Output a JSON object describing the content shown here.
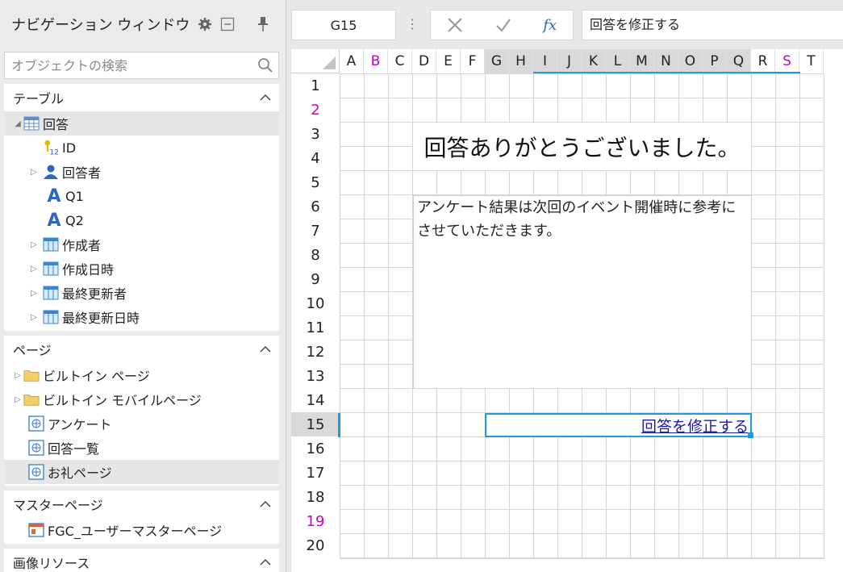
{
  "nav": {
    "title": "ナビゲーション ウィンドウ",
    "search_placeholder": "オブジェクトの検索",
    "tables": {
      "heading": "テーブル",
      "table_name": "回答",
      "fields": [
        {
          "label": "ID",
          "icon": "key-number-icon",
          "expandable": false
        },
        {
          "label": "回答者",
          "icon": "user-icon",
          "expandable": true
        },
        {
          "label": "Q1",
          "icon": "text-field-icon",
          "expandable": false
        },
        {
          "label": "Q2",
          "icon": "text-field-icon",
          "expandable": false
        },
        {
          "label": "作成者",
          "icon": "table-icon",
          "expandable": true
        },
        {
          "label": "作成日時",
          "icon": "table-icon",
          "expandable": true
        },
        {
          "label": "最終更新者",
          "icon": "table-icon",
          "expandable": true
        },
        {
          "label": "最終更新日時",
          "icon": "table-icon",
          "expandable": true
        }
      ]
    },
    "pages": {
      "heading": "ページ",
      "items": [
        {
          "label": "ビルトイン ページ",
          "icon": "folder-icon",
          "expandable": true
        },
        {
          "label": "ビルトイン モバイルページ",
          "icon": "folder-icon",
          "expandable": true
        },
        {
          "label": "アンケート",
          "icon": "page-icon",
          "expandable": false
        },
        {
          "label": "回答一覧",
          "icon": "page-icon",
          "expandable": false
        },
        {
          "label": "お礼ページ",
          "icon": "page-icon",
          "expandable": false,
          "selected": true
        }
      ]
    },
    "master": {
      "heading": "マスターページ",
      "items": [
        {
          "label": "FGC_ユーザーマスターページ",
          "icon": "master-page-icon"
        }
      ]
    },
    "images": {
      "heading": "画像リソース"
    }
  },
  "formula_bar": {
    "cell_ref": "G15",
    "formula": "回答を修正する",
    "fx": "fx"
  },
  "sheet": {
    "columns": [
      "A",
      "B",
      "C",
      "D",
      "E",
      "F",
      "G",
      "H",
      "I",
      "J",
      "K",
      "L",
      "M",
      "N",
      "O",
      "P",
      "Q",
      "R",
      "S",
      "T"
    ],
    "rows": [
      "1",
      "2",
      "3",
      "4",
      "5",
      "6",
      "7",
      "8",
      "9",
      "10",
      "11",
      "12",
      "13",
      "14",
      "15",
      "16",
      "17",
      "18",
      "19",
      "20"
    ],
    "title_text": "回答ありがとうございました。",
    "message_text": "アンケート結果は次回のイベント開催時に参考にさせていただきます。",
    "link_text": "回答を修正する",
    "magenta_color": "#c800c8",
    "accent_color": "#1e9be0"
  }
}
